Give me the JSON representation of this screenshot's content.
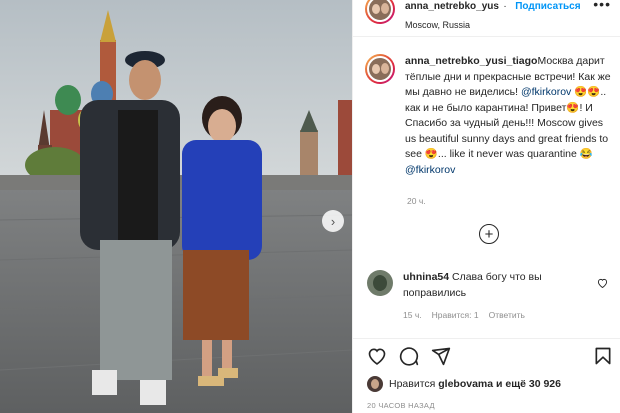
{
  "header": {
    "username": "anna_netrebko_yus",
    "follow_label": "Подписаться",
    "location": "Moscow, Russia",
    "more_label": "•••"
  },
  "caption": {
    "username": "anna_netrebko_yusi_tiago",
    "text_1": "Москва дарит тёплые дни и прекрасные встречи! Как же мы давно не виделись! ",
    "mention_1": "@fkirkorov",
    "text_2": " 😍😍.. как и не было карантина! Привет😍! И Спасибо за чудный день!!! Moscow gives us beautiful sunny days and great friends to see 😍... like it never was quarantine 😂 ",
    "mention_2": "@fkirkorov",
    "timestamp": "20 ч."
  },
  "load_more_label": "+",
  "comment": {
    "username": "uhnina54",
    "text": " Слава богу что вы поправились",
    "time": "15 ч.",
    "likes": "Нравится: 1",
    "reply": "Ответить"
  },
  "likes_line": {
    "prefix": "Нравится ",
    "user": "glebovama",
    "suffix": " и ещё 30 926"
  },
  "post_date": "20 ЧАСОВ НАЗАД",
  "photo": {
    "next_label": "›"
  },
  "icons": [
    "heart-icon",
    "comment-icon",
    "share-icon",
    "bookmark-icon",
    "plus-circle-icon"
  ],
  "colors": {
    "link": "#0095f6",
    "mention": "#00376b",
    "muted": "#8e8e8e"
  }
}
